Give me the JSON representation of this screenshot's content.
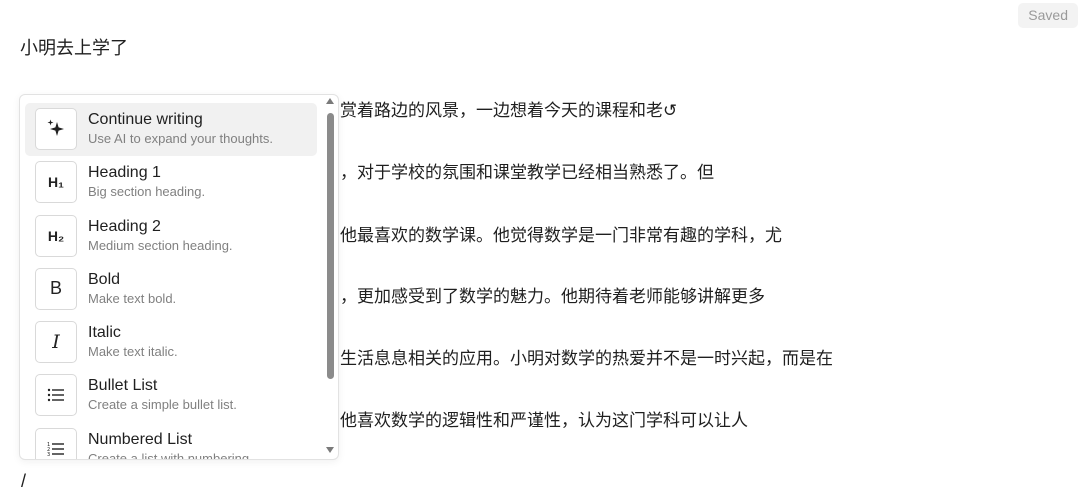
{
  "status": {
    "saved_label": "Saved"
  },
  "document": {
    "title": "小明去上学了",
    "paragraphs": [
      "赏着路边的风景，一边想着今天的课程和老↺",
      "，对于学校的氛围和课堂教学已经相当熟悉了。但",
      "他最喜欢的数学课。他觉得数学是一门非常有趣的学科，尤",
      "，更加感受到了数学的魅力。他期待着老师能够讲解更多",
      "生活息息相关的应用。小明对数学的热爱并不是一时兴起，而是在",
      "他喜欢数学的逻辑性和严谨性，认为这门学科可以让人"
    ],
    "current_line": "/"
  },
  "slash_menu": {
    "items": [
      {
        "title": "Continue writing",
        "description": "Use AI to expand your thoughts.",
        "icon_text": "",
        "icon_name": "sparkles-icon"
      },
      {
        "title": "Heading 1",
        "description": "Big section heading.",
        "icon_text": "H₁",
        "icon_name": "heading-1-icon"
      },
      {
        "title": "Heading 2",
        "description": "Medium section heading.",
        "icon_text": "H₂",
        "icon_name": "heading-2-icon"
      },
      {
        "title": "Bold",
        "description": "Make text bold.",
        "icon_text": "B",
        "icon_name": "bold-icon"
      },
      {
        "title": "Italic",
        "description": "Make text italic.",
        "icon_text": "I",
        "icon_name": "italic-icon"
      },
      {
        "title": "Bullet List",
        "description": "Create a simple bullet list.",
        "icon_text": "",
        "icon_name": "bullet-list-icon"
      },
      {
        "title": "Numbered List",
        "description": "Create a list with numbering.",
        "icon_text": "",
        "icon_name": "numbered-list-icon"
      }
    ]
  }
}
